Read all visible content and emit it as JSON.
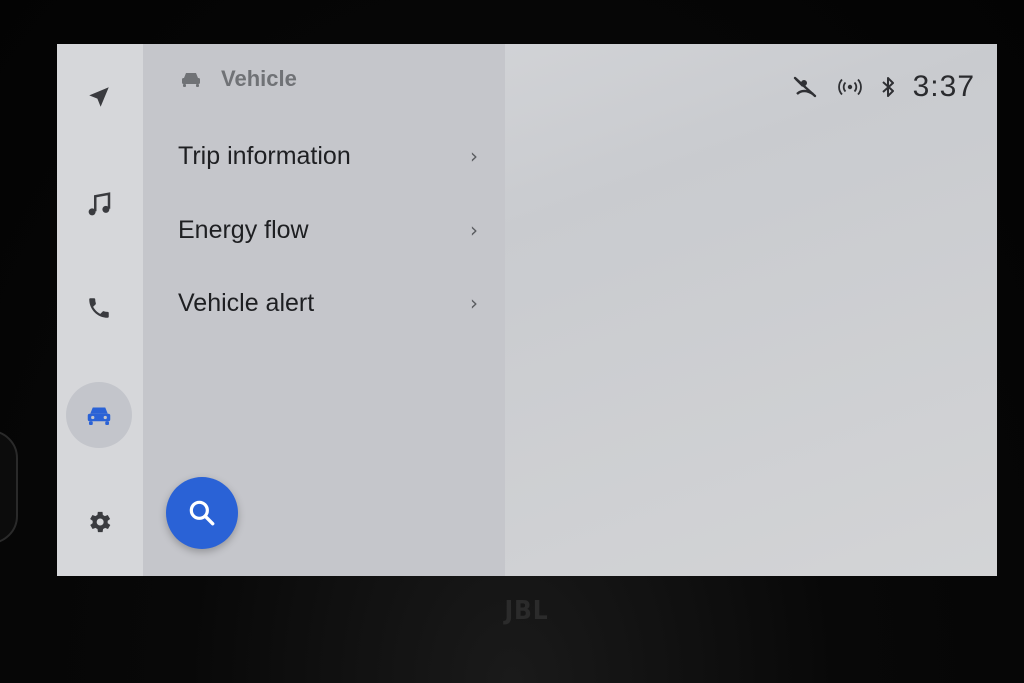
{
  "rail": {
    "items": [
      {
        "icon": "navigation-arrow-icon",
        "active": false
      },
      {
        "icon": "music-note-icon",
        "active": false
      },
      {
        "icon": "phone-icon",
        "active": false
      },
      {
        "icon": "car-icon",
        "active": true
      },
      {
        "icon": "gear-icon",
        "active": false
      }
    ],
    "active_color": "#2a62d6"
  },
  "panel": {
    "header_icon": "car-icon",
    "title": "Vehicle",
    "items": [
      {
        "label": "Trip information",
        "chevron": "›"
      },
      {
        "label": "Energy flow",
        "chevron": "›"
      },
      {
        "label": "Vehicle alert",
        "chevron": "›"
      }
    ]
  },
  "search_button": {
    "icon": "search-icon",
    "color": "#2a62d6"
  },
  "status": {
    "icons": [
      "mic-muted-icon",
      "wireless-signal-icon",
      "bluetooth-icon"
    ],
    "time": "3:37"
  },
  "bezel": {
    "brand": "JBL"
  }
}
